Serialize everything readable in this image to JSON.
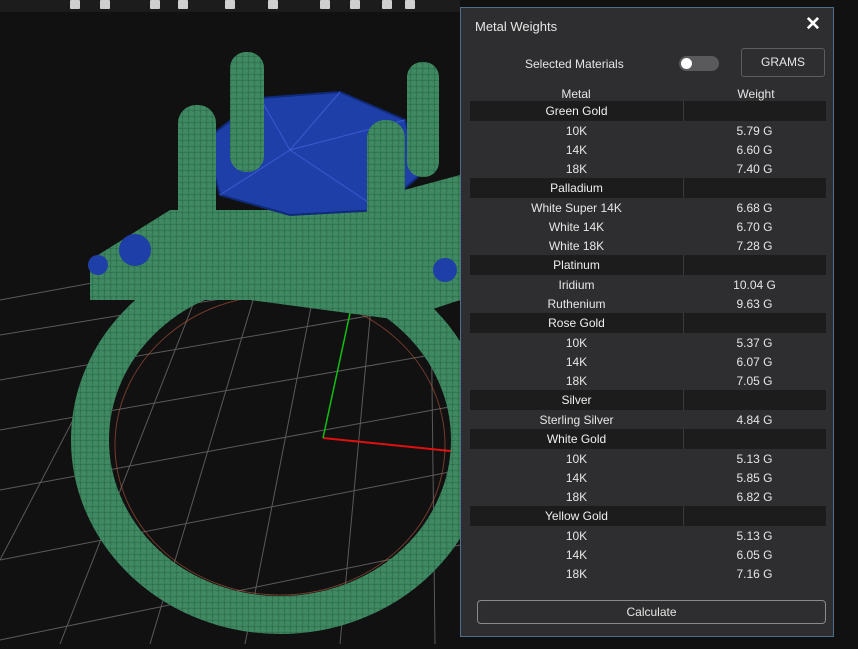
{
  "panel": {
    "title": "Metal Weights",
    "selected_label": "Selected Materials",
    "toggle_on": false,
    "units_label": "GRAMS",
    "col_metal": "Metal",
    "col_weight": "Weight",
    "calculate_label": "Calculate",
    "groups": [
      {
        "name": "Green Gold",
        "rows": [
          {
            "name": "10K",
            "value": "5.79 G"
          },
          {
            "name": "14K",
            "value": "6.60 G"
          },
          {
            "name": "18K",
            "value": "7.40 G"
          }
        ]
      },
      {
        "name": "Palladium",
        "rows": [
          {
            "name": "White Super 14K",
            "value": "6.68 G"
          },
          {
            "name": "White 14K",
            "value": "6.70 G"
          },
          {
            "name": "White 18K",
            "value": "7.28 G"
          }
        ]
      },
      {
        "name": "Platinum",
        "rows": [
          {
            "name": "Iridium",
            "value": "10.04 G"
          },
          {
            "name": "Ruthenium",
            "value": "9.63 G"
          }
        ]
      },
      {
        "name": "Rose Gold",
        "rows": [
          {
            "name": "10K",
            "value": "5.37 G"
          },
          {
            "name": "14K",
            "value": "6.07 G"
          },
          {
            "name": "18K",
            "value": "7.05 G"
          }
        ]
      },
      {
        "name": "Silver",
        "rows": [
          {
            "name": "Sterling Silver",
            "value": "4.84 G"
          }
        ]
      },
      {
        "name": "White Gold",
        "rows": [
          {
            "name": "10K",
            "value": "5.13 G"
          },
          {
            "name": "14K",
            "value": "5.85 G"
          },
          {
            "name": "18K",
            "value": "6.82 G"
          }
        ]
      },
      {
        "name": "Yellow Gold",
        "rows": [
          {
            "name": "10K",
            "value": "5.13 G"
          },
          {
            "name": "14K",
            "value": "6.05 G"
          },
          {
            "name": "18K",
            "value": "7.16 G"
          }
        ]
      }
    ]
  },
  "colors": {
    "ring_green": "#3f8a63",
    "gem_blue": "#1f3fa8",
    "axis_red": "#e01010",
    "axis_green": "#10c010",
    "panel_border": "#4e6f8a"
  },
  "icons": {
    "close": "close-icon",
    "toolbar": "toolbar-icons"
  }
}
